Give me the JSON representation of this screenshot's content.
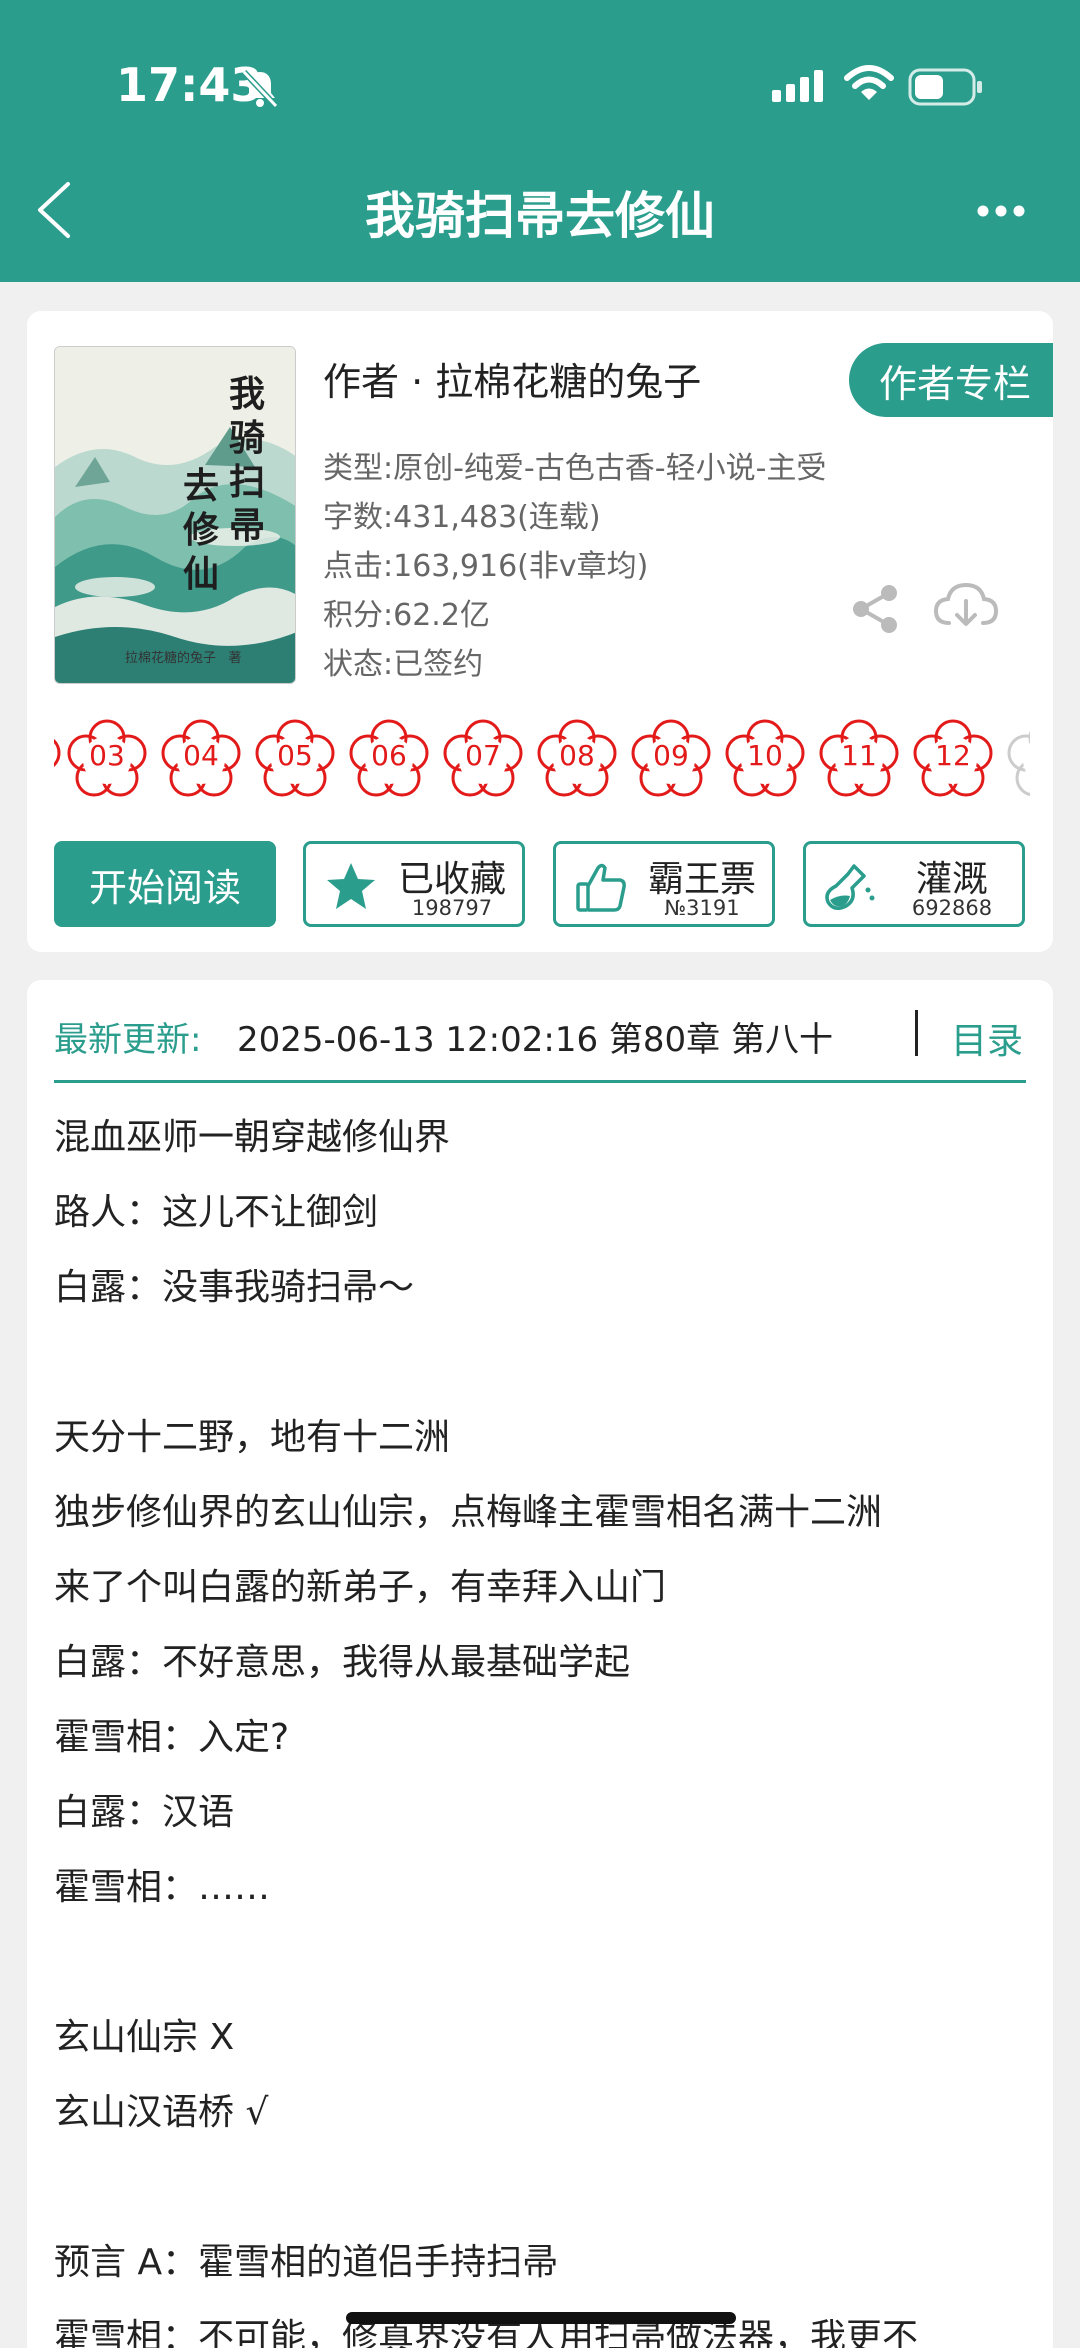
{
  "status_bar": {
    "time": "17:43",
    "icons": [
      "bell-slash-icon",
      "signal-icon",
      "wifi-icon",
      "battery-icon"
    ]
  },
  "nav": {
    "title": "我骑扫帚去修仙",
    "back_icon": "chevron-left-icon",
    "more_icon": "more-dots-icon"
  },
  "book": {
    "cover_title_chars": [
      "我",
      "骑",
      "扫",
      "帚",
      "去",
      "修",
      "仙"
    ],
    "cover_author": "拉棉花糖的兔子",
    "cover_author_suffix": "著",
    "author_line": "作者 · 拉棉花糖的兔子",
    "author_column_button": "作者专栏",
    "meta": {
      "type": "类型:原创-纯爱-古色古香-轻小说-主受",
      "words": "字数:431,483(连载)",
      "clicks": "点击:163,916(非v章均)",
      "points": "积分:62.2亿",
      "status": "状态:已签约"
    },
    "flower_numbers": [
      "03",
      "04",
      "05",
      "06",
      "07",
      "08",
      "09",
      "10",
      "11",
      "12"
    ]
  },
  "actions": {
    "start_read": "开始阅读",
    "favorite": {
      "label": "已收藏",
      "count": "198797"
    },
    "ticket": {
      "label": "霸王票",
      "count": "№3191"
    },
    "irrigate": {
      "label": "灌溉",
      "count": "692868"
    }
  },
  "update": {
    "label": "最新更新:",
    "text": "2025-06-13 12:02:16   第80章 第八十",
    "toc": "目录"
  },
  "synopsis": [
    "混血巫师一朝穿越修仙界",
    "路人：这儿不让御剑",
    "白露：没事我骑扫帚～",
    "",
    "天分十二野，地有十二洲",
    "独步修仙界的玄山仙宗，点梅峰主霍雪相名满十二洲",
    "来了个叫白露的新弟子，有幸拜入山门",
    "白露：不好意思，我得从最基础学起",
    "霍雪相：入定?",
    "白露：汉语",
    "霍雪相：……",
    "",
    "玄山仙宗 X",
    "玄山汉语桥 √",
    "",
    "预言 A：霍雪相的道侣手持扫帚",
    "霍雪相：不可能，修真界没有人用扫帚做法器，我更不"
  ],
  "colors": {
    "accent": "#2a9d8d",
    "flower_red": "#e31a1a"
  }
}
